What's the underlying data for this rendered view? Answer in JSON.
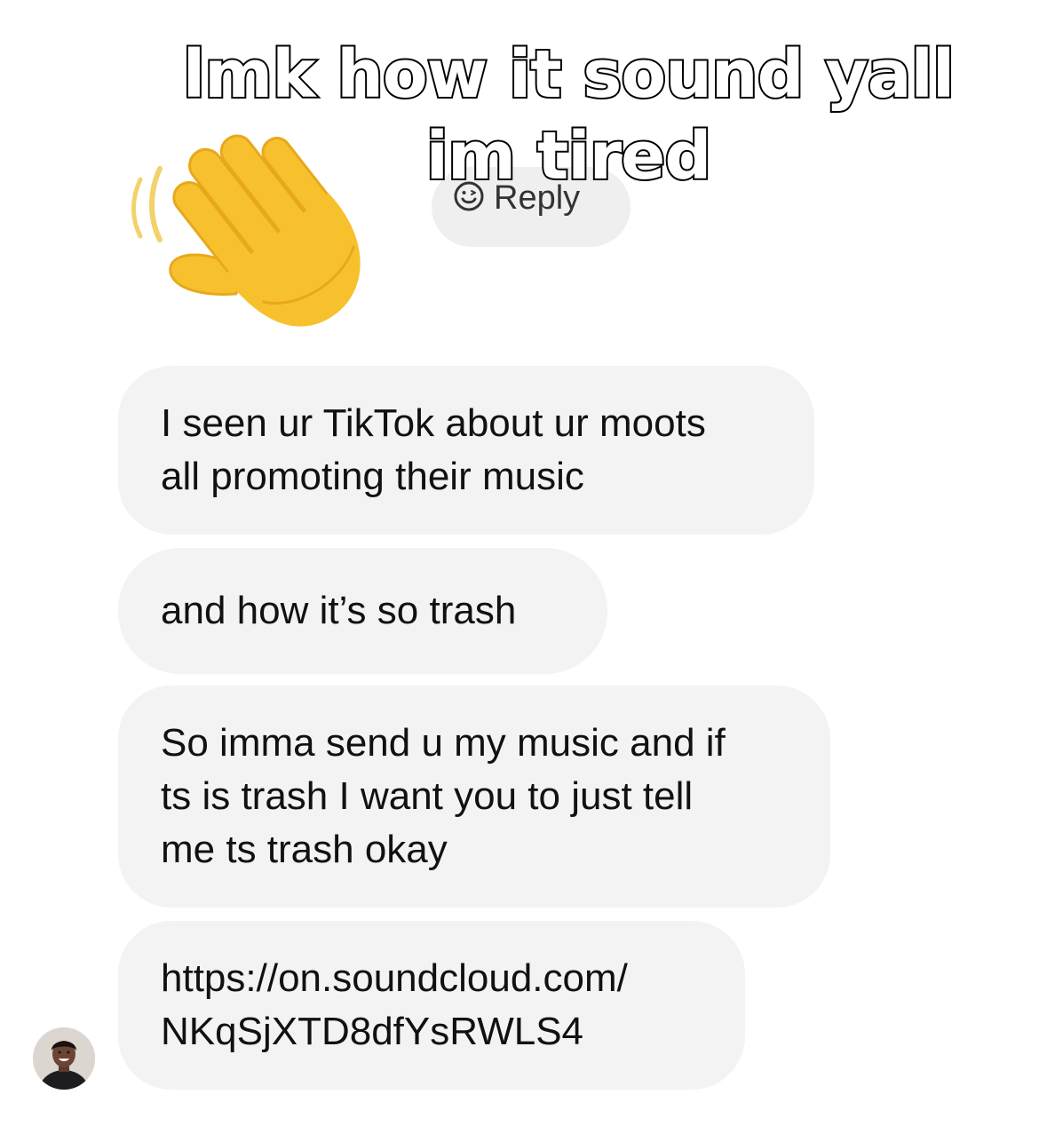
{
  "overlay": {
    "caption": "lmk how it sound yall im tired"
  },
  "reaction_emoji": {
    "icon": "waving-hand-icon"
  },
  "reply_chip": {
    "icon": "smiley-face-icon",
    "label": "Reply"
  },
  "messages": [
    {
      "text": "I seen ur TikTok about ur moots\nall promoting their music"
    },
    {
      "text": "and how it’s so trash"
    },
    {
      "text": "So imma send u my music and if\nts is trash I want you to just tell\nme ts trash okay"
    },
    {
      "text": "https://on.soundcloud.com/\nNKqSjXTD8dfYsRWLS4"
    }
  ],
  "sender": {
    "avatar_icon": "profile-avatar"
  },
  "colors": {
    "bubble_bg": "#f3f3f3",
    "chip_bg": "#efefef",
    "text": "#111111",
    "caption_fill": "#ffffff",
    "caption_stroke": "#000000",
    "hand": "#f7c12e"
  }
}
